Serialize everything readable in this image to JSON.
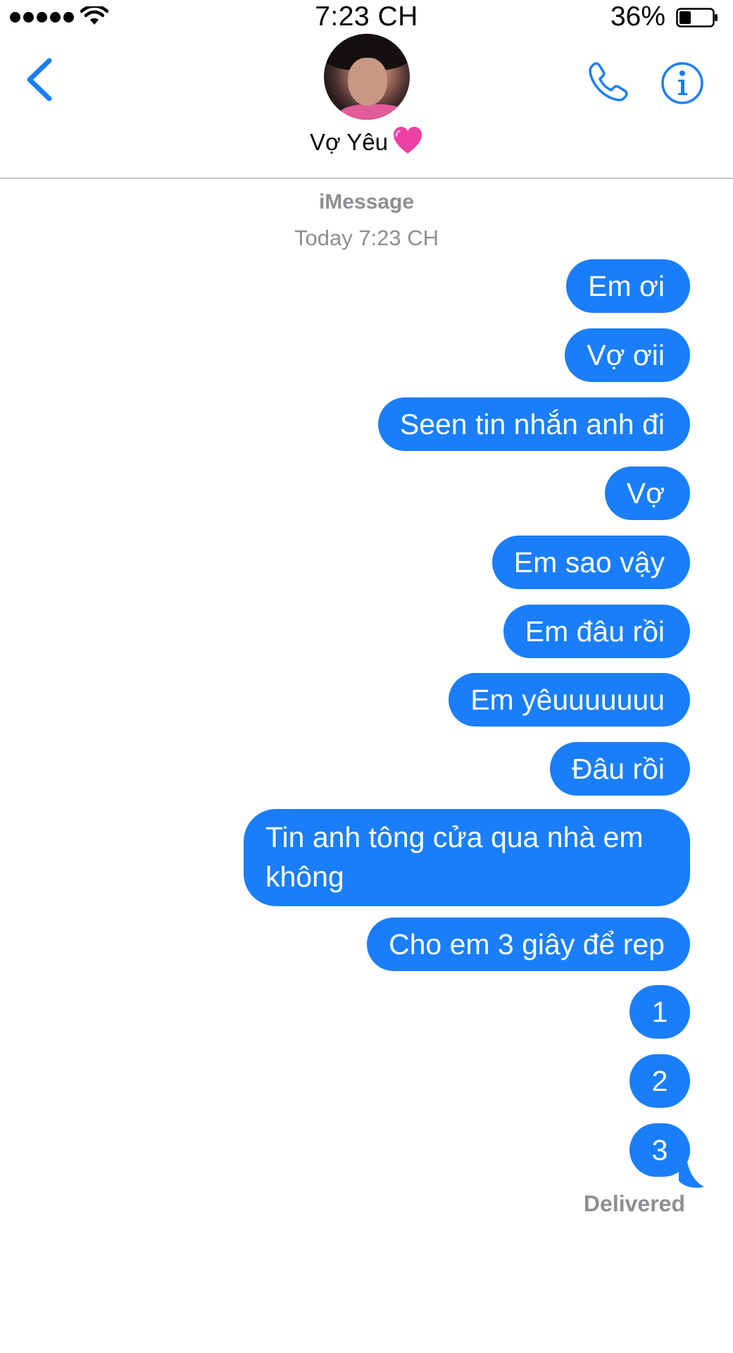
{
  "status_bar": {
    "time": "7:23 CH",
    "battery_percent": "36%",
    "battery_level": 0.36,
    "signal_bars": 5
  },
  "header": {
    "contact_name": "Vợ Yêu",
    "icons": [
      "chevron-left-icon",
      "avatar",
      "heart-icon",
      "phone-icon",
      "info-icon"
    ],
    "accent_color": "#1a7efb"
  },
  "thread": {
    "service": "iMessage",
    "timestamp": "Today 7:23 CH",
    "bubble_color": "#1a7efb",
    "messages": [
      {
        "text": "Em ơi"
      },
      {
        "text": "Vợ ơii"
      },
      {
        "text": "Seen tin nhắn anh đi"
      },
      {
        "text": "Vợ"
      },
      {
        "text": "Em sao vậy"
      },
      {
        "text": "Em đâu rồi"
      },
      {
        "text": "Em yêuuuuuuu"
      },
      {
        "text": "Đâu rồi"
      },
      {
        "text": "Tin anh tông cửa qua nhà em không"
      },
      {
        "text": "Cho em 3 giây để rep"
      },
      {
        "text": "1"
      },
      {
        "text": "2"
      },
      {
        "text": "3"
      }
    ],
    "status": "Delivered"
  }
}
